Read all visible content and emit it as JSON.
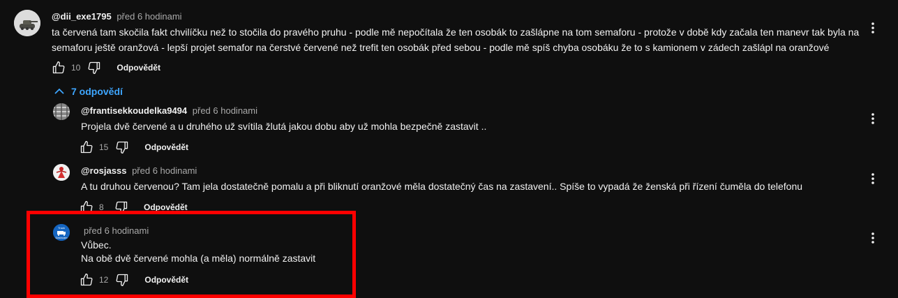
{
  "top_comment": {
    "author": "@dii_exe1795",
    "time": "před 6 hodinami",
    "text_line1": "ta červená tam skočila fakt chvilíčku než to stočila do pravého pruhu - podle mě nepočítala že ten osobák to zašlápne na tom semaforu -  protože v době kdy začala ten manevr tak byla na",
    "text_line2": "semaforu ještě oranžová - lepší projet semafor na čerstvé červené než trefit ten osobák před sebou - podle mě spíš chyba osobáku že to s kamionem v zádech zašlápl na oranžové",
    "likes": "10",
    "reply_label": "Odpovědět"
  },
  "replies_toggle": {
    "label": "7 odpovědí"
  },
  "replies": [
    {
      "author": "@frantisekkoudelka9494",
      "time": "před 6 hodinami",
      "text": "Projela dvě červené a u druhého už svítila žlutá jakou dobu aby už mohla bezpečně zastavit ..",
      "likes": "15",
      "reply_label": "Odpovědět"
    },
    {
      "author": "@rosjasss",
      "time": "před 6 hodinami",
      "text": "A tu druhou červenou? Tam jela dostatečně pomalu a při  bliknutí oranžové měla dostatečný čas na zastavení.. Spíše to vypadá že ženská při  řízení čuměla do telefonu",
      "likes": "8",
      "reply_label": "Odpovědět"
    },
    {
      "author": "",
      "time": "před 6 hodinami",
      "text_line1": "Vůbec.",
      "text_line2": "Na obě dvě červené mohla (a měla) normálně zastavit",
      "likes": "12",
      "reply_label": "Odpovědět",
      "avatar_text_line1": "Truck",
      "avatar_text_line2": "Dashcam"
    }
  ],
  "colors": {
    "background": "#0f0f0f",
    "text": "#f1f1f1",
    "secondary": "#aaaaaa",
    "link": "#3ea6ff",
    "highlight": "#ff0000"
  }
}
